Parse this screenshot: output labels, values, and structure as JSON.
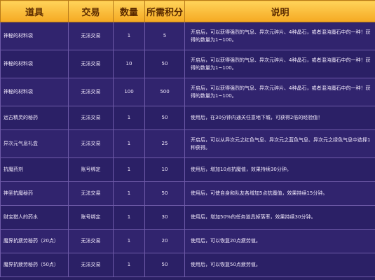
{
  "headers": [
    "道具",
    "交易",
    "数量",
    "所需积分",
    "说明"
  ],
  "rows": [
    {
      "item": "神秘的材料袋",
      "trade": "无法交易",
      "qty": "1",
      "points": "5",
      "desc": "开启后，可以获得强烈的气息、异次元碎片、4种晶石，或者混沌魔石中的一种！获得的数量为1~100。"
    },
    {
      "item": "神秘的材料袋",
      "trade": "无法交易",
      "qty": "10",
      "points": "50",
      "desc": "开启后，可以获得强烈的气息、异次元碎片、4种晶石，或者混沌魔石中的一种！获得的数量为1~100。"
    },
    {
      "item": "神秘的材料袋",
      "trade": "无法交易",
      "qty": "100",
      "points": "500",
      "desc": "开启后，可以获得强烈的气息、异次元碎片、4种晶石，或者混沌魔石中的一种！获得的数量为1~100。"
    },
    {
      "item": "远古精灵的秘药",
      "trade": "无法交易",
      "qty": "1",
      "points": "50",
      "desc": "使用后，在30分钟内通关任意地下城，可获得2倍的经验值！"
    },
    {
      "item": "异次元气息礼盒",
      "trade": "无法交易",
      "qty": "1",
      "points": "25",
      "desc": "开启后，可以从异次元之红色气息、异次元之蓝色气息、异次元之绿色气息中选择1种获得。"
    },
    {
      "item": "抗魔药剂",
      "trade": "账号绑定",
      "qty": "1",
      "points": "10",
      "desc": "使用后，增加10点抗魔值，效果持续30分钟。"
    },
    {
      "item": "神圣抗魔秘药",
      "trade": "无法交易",
      "qty": "1",
      "points": "50",
      "desc": "使用后，可使自身和队友各增加5点抗魔值，效果持续15分钟。"
    },
    {
      "item": "财宝猎人的药水",
      "trade": "账号绑定",
      "qty": "1",
      "points": "30",
      "desc": "使用后，增加50%的任务道具掉落率，效果持续30分钟。"
    },
    {
      "item": "魔界抗疲劳秘药（20点）",
      "trade": "无法交易",
      "qty": "1",
      "points": "20",
      "desc": "使用后，可以恢复20点疲劳值。"
    },
    {
      "item": "魔界抗疲劳秘药（50点）",
      "trade": "无法交易",
      "qty": "1",
      "points": "50",
      "desc": "使用后，可以恢复50点疲劳值。"
    }
  ]
}
